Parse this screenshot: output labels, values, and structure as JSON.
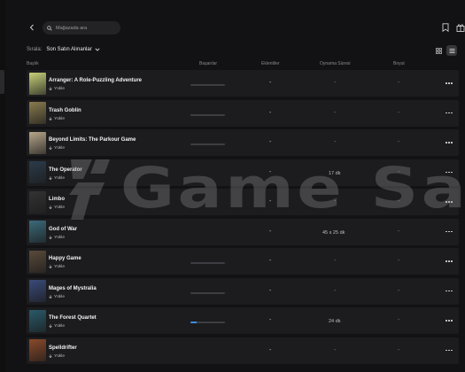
{
  "search": {
    "placeholder": "Mağazada ara"
  },
  "sort": {
    "label": "Sırala:",
    "value": "Son Satın Alınanlar"
  },
  "columns": {
    "title": "Başlık",
    "achievements": "Başarılar",
    "addons": "Eklentiler",
    "playtime": "Oynama Süresi",
    "size": "Boyut"
  },
  "install_label": "Yükle",
  "games": [
    {
      "title": "Arranger: A Role-Puzzling Adventure",
      "achievements": 0.0,
      "addons": "-",
      "playtime": "-",
      "size": "-",
      "thumb_color": "#c8d07a"
    },
    {
      "title": "Trash Goblin",
      "achievements": 0.0,
      "addons": "-",
      "playtime": "-",
      "size": "-",
      "thumb_color": "#8a7b4e"
    },
    {
      "title": "Beyond Limits: The Parkour Game",
      "achievements": 0.0,
      "addons": "-",
      "playtime": "-",
      "size": "-",
      "thumb_color": "#b7a78a"
    },
    {
      "title": "The Operator",
      "achievements": null,
      "addons": "-",
      "playtime": "17 dk",
      "size": "-",
      "thumb_color": "#2b3b4a"
    },
    {
      "title": "Limbo",
      "achievements": null,
      "addons": "-",
      "playtime": "-",
      "size": "-",
      "thumb_color": "#333333"
    },
    {
      "title": "God of War",
      "achievements": null,
      "addons": "-",
      "playtime": "45 s 25 dk",
      "size": "-",
      "thumb_color": "#3b6a7a"
    },
    {
      "title": "Happy Game",
      "achievements": 0.0,
      "addons": "-",
      "playtime": "-",
      "size": "-",
      "thumb_color": "#5a4a3a"
    },
    {
      "title": "Mages of Mystralia",
      "achievements": 0.0,
      "addons": "-",
      "playtime": "-",
      "size": "-",
      "thumb_color": "#3a4b7a"
    },
    {
      "title": "The Forest Quartet",
      "achievements": 0.18,
      "addons": "-",
      "playtime": "24 dk",
      "size": "-",
      "thumb_color": "#2a5a6a"
    },
    {
      "title": "Spelldrifter",
      "achievements": null,
      "addons": "-",
      "playtime": "-",
      "size": "-",
      "thumb_color": "#8a4a2a"
    }
  ],
  "watermark": {
    "text": "Game Satış"
  },
  "colors": {
    "accent": "#3b8be0",
    "background": "#121214",
    "row": "#1c1c1f"
  }
}
